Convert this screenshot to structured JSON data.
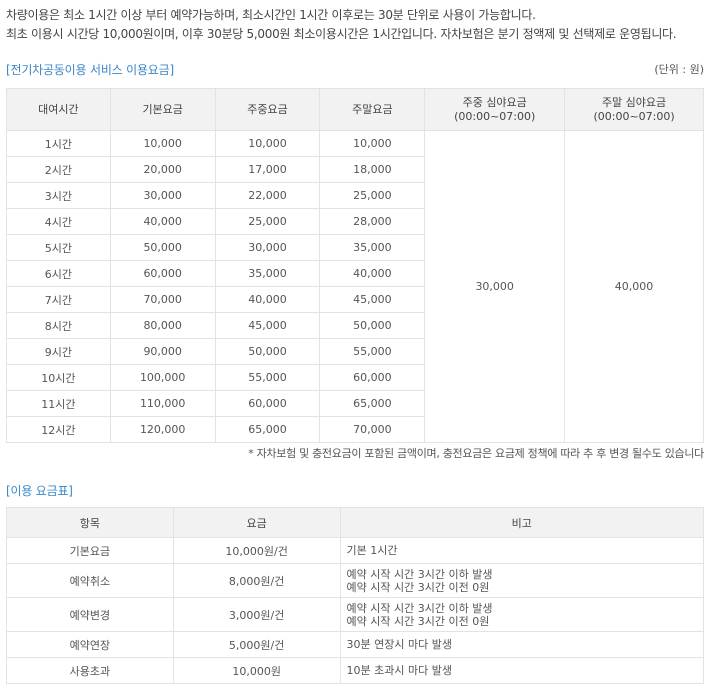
{
  "intro": {
    "line1": "차량이용은 최소 1시간 이상 부터 예약가능하며, 최소시간인 1시간 이후로는 30분 단위로 사용이 가능합니다.",
    "line2": "최초 이용시 시간당 10,000원이며, 이후 30분당 5,000원 최소이용시간은 1시간입니다. 자차보험은 분기 정액제 및 선택제로 운영됩니다."
  },
  "fee_section": {
    "title": "[전기차공동이용 서비스 이용요금]",
    "unit": "(단위 : 원)",
    "headers": {
      "duration": "대여시간",
      "basic": "기본요금",
      "weekday": "주중요금",
      "weekend": "주말요금",
      "weekday_night": "주중 심야요금",
      "weekday_night_sub": "(00:00~07:00)",
      "weekend_night": "주말 심야요금",
      "weekend_night_sub": "(00:00~07:00)"
    },
    "rows": [
      {
        "duration": "1시간",
        "basic": "10,000",
        "weekday": "10,000",
        "weekend": "10,000"
      },
      {
        "duration": "2시간",
        "basic": "20,000",
        "weekday": "17,000",
        "weekend": "18,000"
      },
      {
        "duration": "3시간",
        "basic": "30,000",
        "weekday": "22,000",
        "weekend": "25,000"
      },
      {
        "duration": "4시간",
        "basic": "40,000",
        "weekday": "25,000",
        "weekend": "28,000"
      },
      {
        "duration": "5시간",
        "basic": "50,000",
        "weekday": "30,000",
        "weekend": "35,000"
      },
      {
        "duration": "6시간",
        "basic": "60,000",
        "weekday": "35,000",
        "weekend": "40,000"
      },
      {
        "duration": "7시간",
        "basic": "70,000",
        "weekday": "40,000",
        "weekend": "45,000"
      },
      {
        "duration": "8시간",
        "basic": "80,000",
        "weekday": "45,000",
        "weekend": "50,000"
      },
      {
        "duration": "9시간",
        "basic": "90,000",
        "weekday": "50,000",
        "weekend": "55,000"
      },
      {
        "duration": "10시간",
        "basic": "100,000",
        "weekday": "55,000",
        "weekend": "60,000"
      },
      {
        "duration": "11시간",
        "basic": "110,000",
        "weekday": "60,000",
        "weekend": "65,000"
      },
      {
        "duration": "12시간",
        "basic": "120,000",
        "weekday": "65,000",
        "weekend": "70,000"
      }
    ],
    "weekday_night_value": "30,000",
    "weekend_night_value": "40,000",
    "note": "* 자차보험 및 충전요금이 포함된 금액이며, 충전요금은 요금제 정책에 따라 추 후 변경 될수도 있습니다"
  },
  "usage_section": {
    "title": "[이용 요금표]",
    "headers": {
      "item": "항목",
      "fee": "요금",
      "remark": "비고"
    },
    "rows": [
      {
        "item": "기본요금",
        "fee": "10,000원/건",
        "remark1": "기본 1시간",
        "remark2": ""
      },
      {
        "item": "예약취소",
        "fee": "8,000원/건",
        "remark1": "예약 시작 시간 3시간 이하 발생",
        "remark2": "예약 시작 시간 3시간 이전 0원"
      },
      {
        "item": "예약변경",
        "fee": "3,000원/건",
        "remark1": "예약 시작 시간 3시간 이하 발생",
        "remark2": "예약 시작 시간 3시간 이전 0원"
      },
      {
        "item": "예약연장",
        "fee": "5,000원/건",
        "remark1": "30분 연장시 마다 발생",
        "remark2": ""
      },
      {
        "item": "사용초과",
        "fee": "10,000원",
        "remark1": "10분 초과시 마다 발생",
        "remark2": ""
      }
    ]
  }
}
